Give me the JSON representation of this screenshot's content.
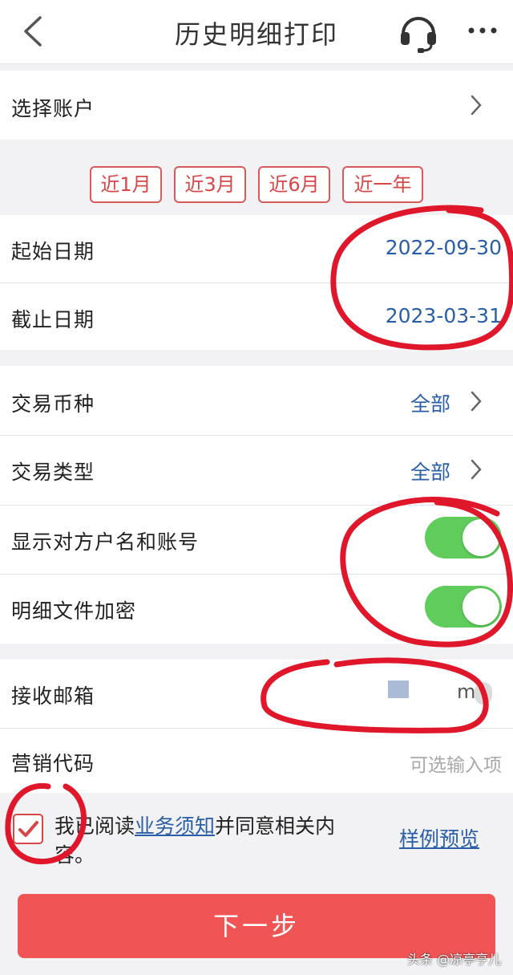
{
  "header": {
    "title": "历史明细打印",
    "icons": [
      "chevron-left-icon",
      "headset-icon",
      "more-icon"
    ]
  },
  "account": {
    "label": "选择账户"
  },
  "quick_ranges": [
    "近1月",
    "近3月",
    "近6月",
    "近一年"
  ],
  "dates": {
    "start_label": "起始日期",
    "start_value": "2022-09-30",
    "end_label": "截止日期",
    "end_value": "2023-03-31"
  },
  "filters": {
    "currency_label": "交易币种",
    "currency_value": "全部",
    "type_label": "交易类型",
    "type_value": "全部"
  },
  "toggles": {
    "show_counterparty_label": "显示对方户名和账号",
    "show_counterparty_on": true,
    "encrypt_label": "明细文件加密",
    "encrypt_on": true
  },
  "email": {
    "label": "接收邮箱",
    "value_fragment": "m"
  },
  "marketing": {
    "label": "营销代码",
    "placeholder": "可选输入项"
  },
  "agreement": {
    "checked": true,
    "text_before": "我已阅读",
    "link": "业务须知",
    "text_after": "并同意相关内容。",
    "sample_link": "样例预览"
  },
  "next_button": "下一步",
  "watermark": "头条 @凉亭亨儿",
  "colors": {
    "accent_red": "#f05454",
    "link_blue": "#2a5fa8",
    "toggle_green": "#5fcc5c",
    "annotation_red": "#e0162b"
  }
}
